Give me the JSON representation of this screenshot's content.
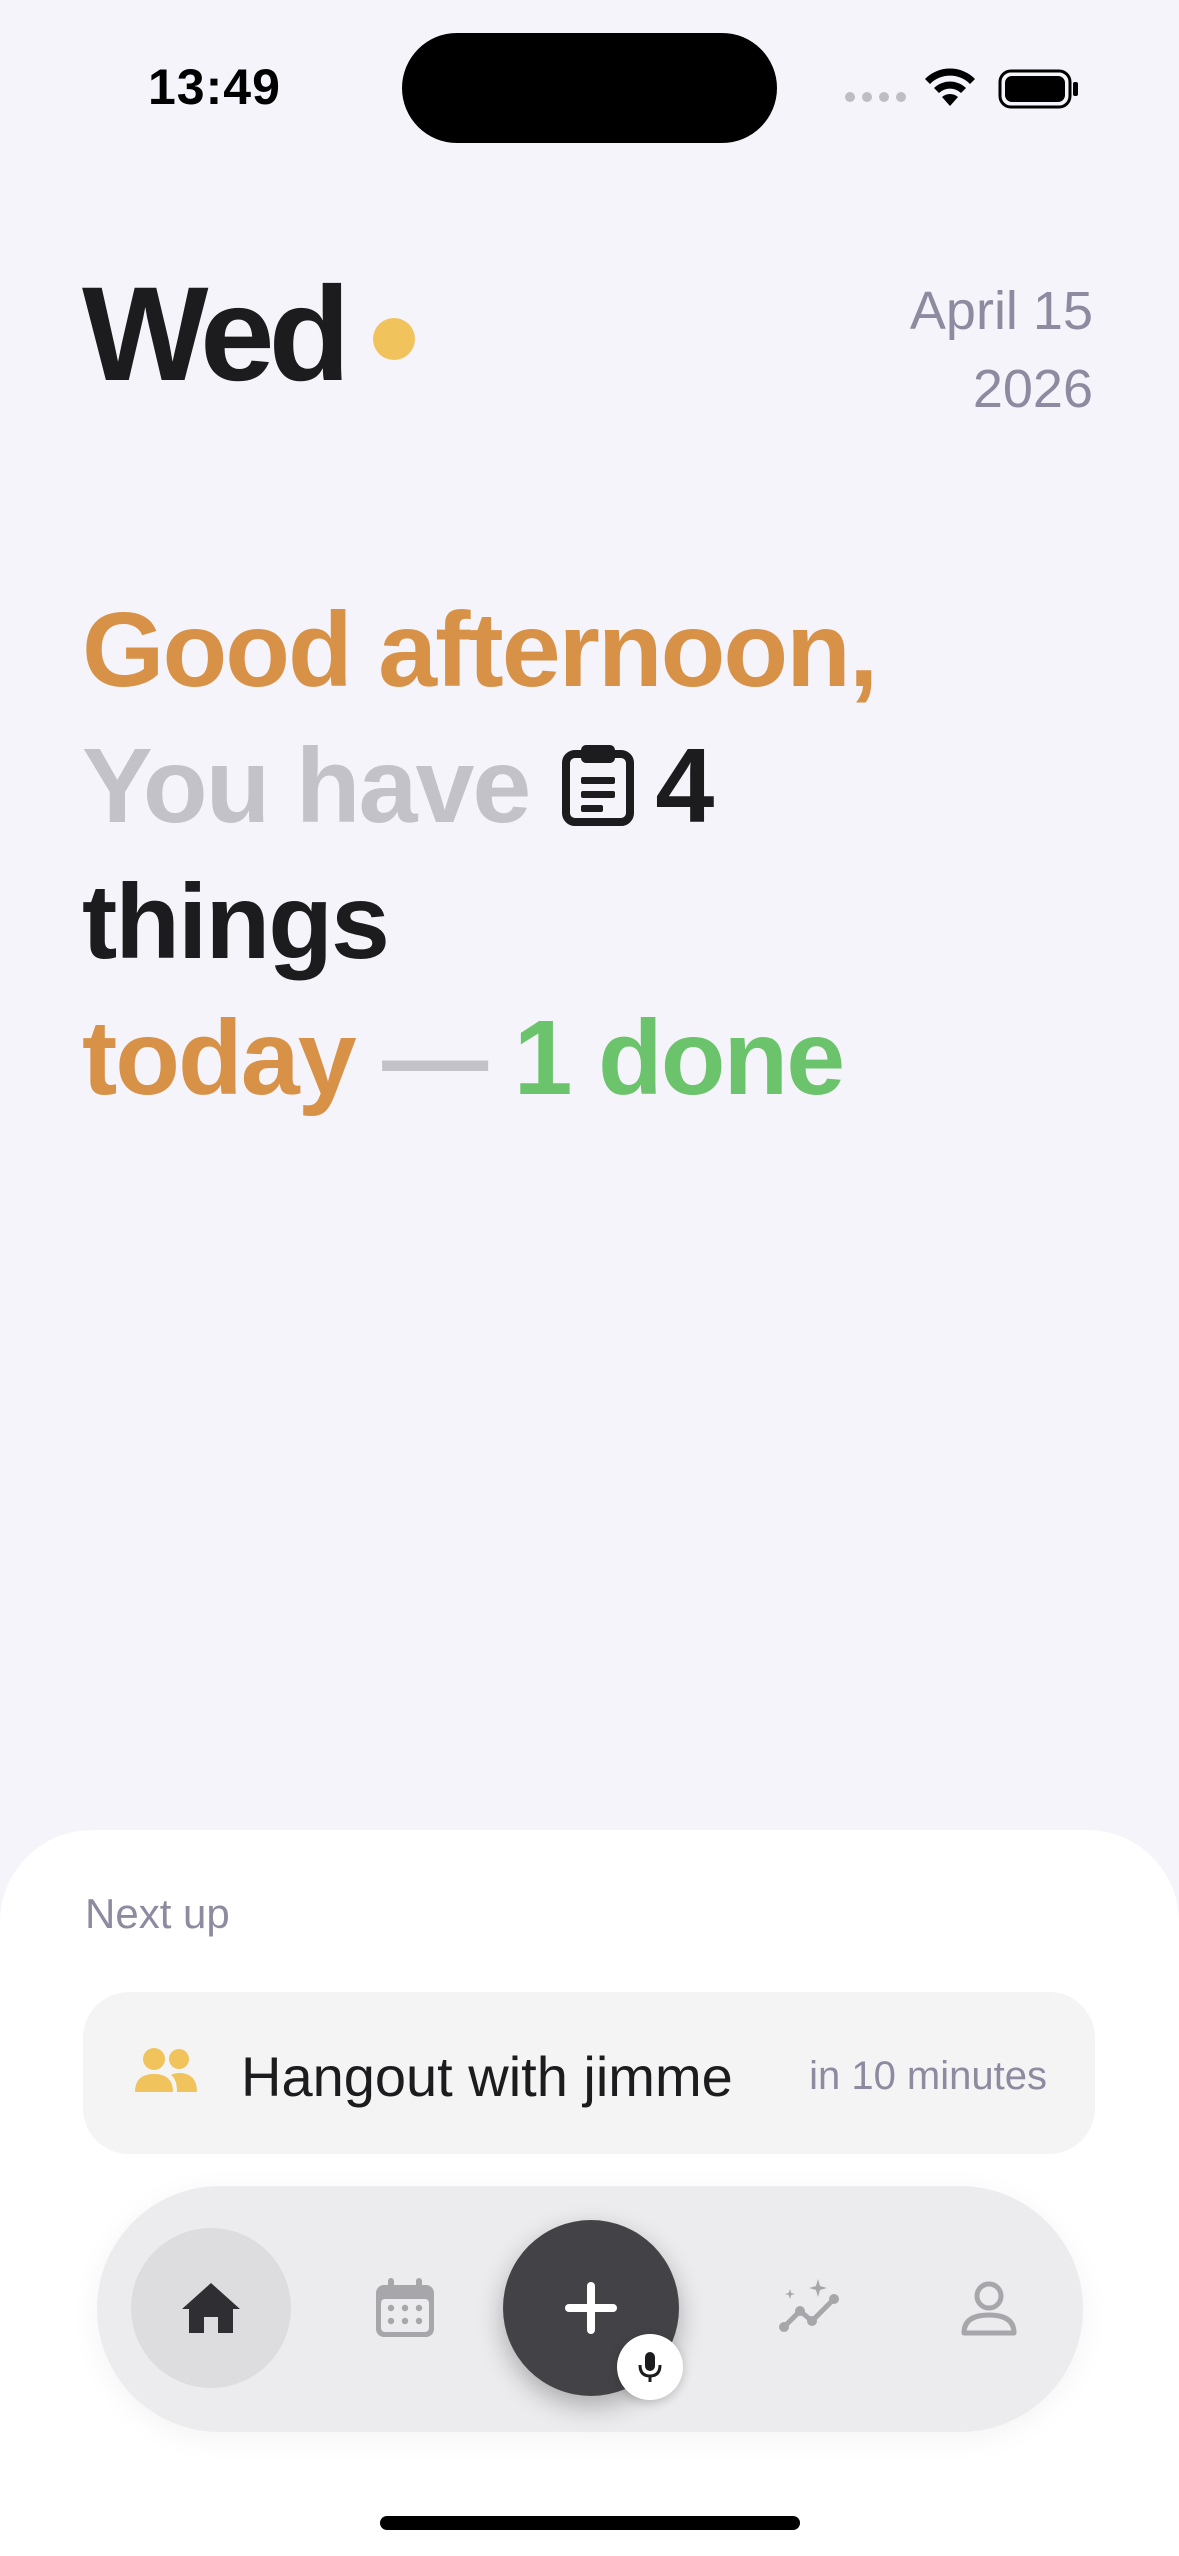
{
  "status_bar": {
    "time": "13:49",
    "icons": [
      "signal-dots-icon",
      "wifi-icon",
      "battery-icon"
    ]
  },
  "header": {
    "day": "Wed",
    "date_line1": "April 15",
    "date_line2": "2026",
    "dot_color": "#F0C35C"
  },
  "greeting": {
    "salutation": "Good afternoon,",
    "you_have": "You have",
    "count": "4",
    "things": "things",
    "today": "today",
    "dash": "—",
    "done": "1 done",
    "icon": "clipboard-icon"
  },
  "next_up": {
    "label": "Next up",
    "event_title": "Hangout with jimme",
    "event_time": "in 10 minutes",
    "icon": "people-icon"
  },
  "tab_bar": {
    "items": [
      {
        "name": "home",
        "icon": "home-icon",
        "active": true
      },
      {
        "name": "calendar",
        "icon": "calendar-icon",
        "active": false
      },
      {
        "name": "add",
        "icon": "plus-icon",
        "active": false
      },
      {
        "name": "insights",
        "icon": "sparkle-chart-icon",
        "active": false
      },
      {
        "name": "profile",
        "icon": "person-icon",
        "active": false
      }
    ],
    "mic_icon": "microphone-icon"
  },
  "colors": {
    "background": "#F5F4FA",
    "orange": "#D89248",
    "green": "#6BC46C",
    "muted": "#8E8A9F",
    "accent_yellow": "#F0C35C"
  }
}
